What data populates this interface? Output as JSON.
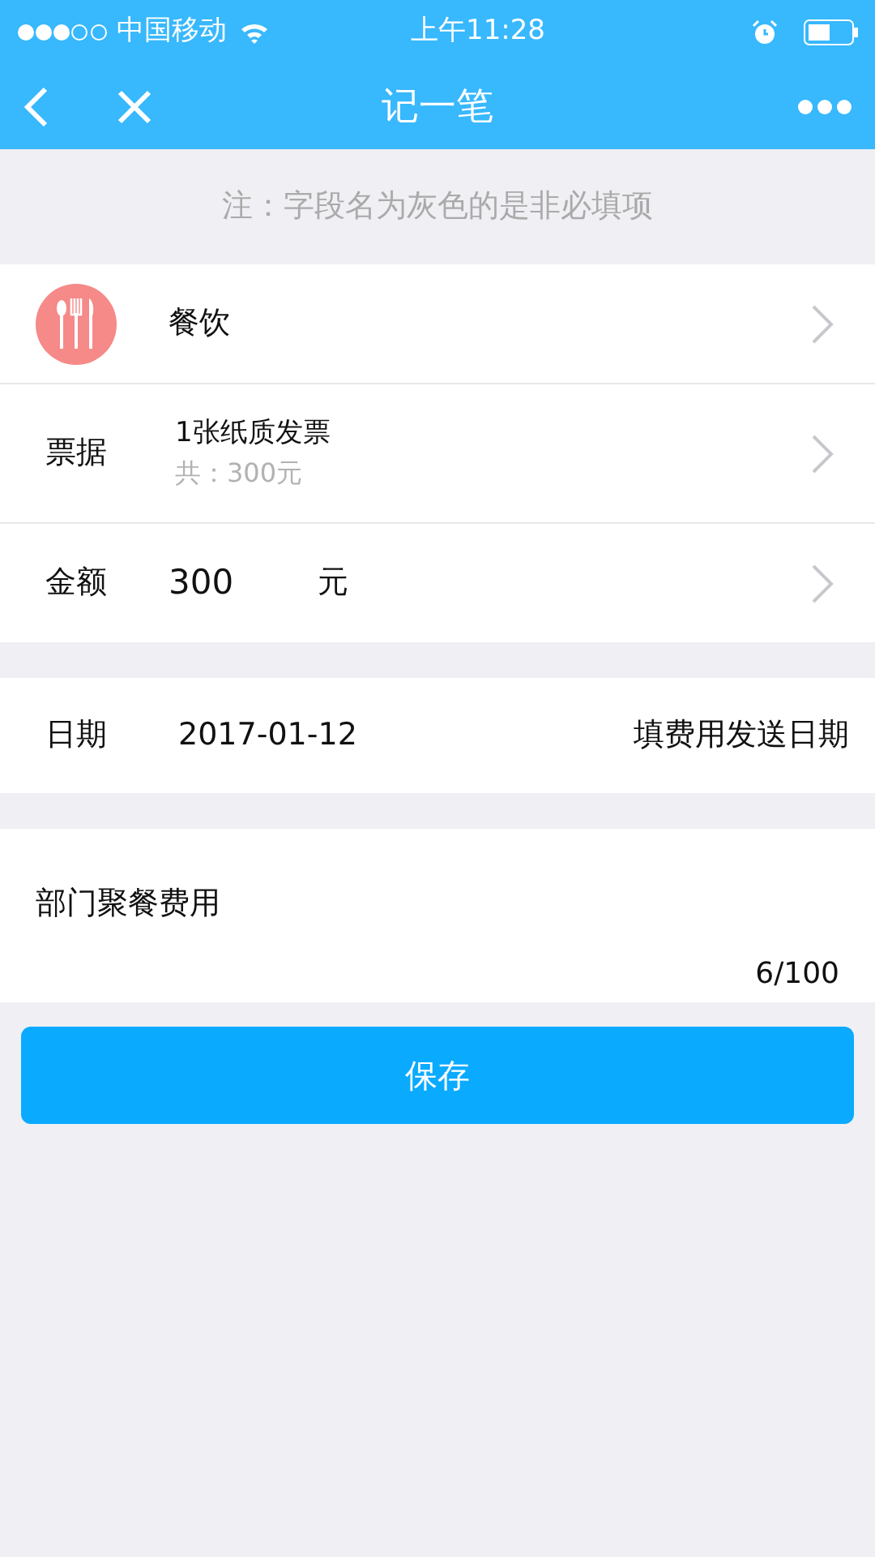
{
  "status_bar": {
    "carrier": "中国移动",
    "time": "上午11:28"
  },
  "nav_bar": {
    "title": "记一笔"
  },
  "note": "注：字段名为灰色的是非必填项",
  "category_row": {
    "label": "餐饮"
  },
  "receipt_row": {
    "label": "票据",
    "title": "1张纸质发票",
    "subtitle": "共：300元"
  },
  "amount_row": {
    "label": "金额",
    "value": "300",
    "unit": "元"
  },
  "date_row": {
    "label": "日期",
    "value": "2017-01-12",
    "hint": "填费用发送日期"
  },
  "remark": {
    "value": "部门聚餐费用",
    "counter": "6/100"
  },
  "save_button": {
    "label": "保存"
  }
}
